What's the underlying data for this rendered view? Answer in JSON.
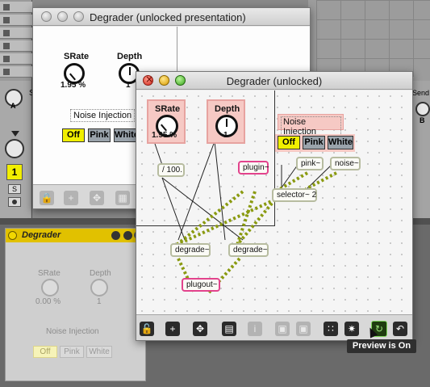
{
  "back_window": {
    "title": "Degrader (unlocked presentation)",
    "srate_label": "SRate",
    "srate_value": "1.95 %",
    "depth_label": "Depth",
    "depth_value": "1",
    "noise_label": "Noise Injection",
    "noise_options": [
      "Off",
      "Pink",
      "White"
    ]
  },
  "front_window": {
    "title": "Degrader (unlocked)",
    "srate_label": "SRate",
    "srate_value": "1.95 %",
    "depth_label": "Depth",
    "depth_value": "1",
    "noise_label": "Noise Injection",
    "noise_options": [
      "Off",
      "Pink",
      "White"
    ],
    "objects": {
      "divide": "/ 100.",
      "plugin": "plugin~",
      "pink": "pink~",
      "noise": "noise~",
      "selector": "selector~ 2",
      "degrade_left": "degrade~",
      "degrade_right": "degrade~",
      "plugout": "plugout~"
    }
  },
  "device": {
    "title": "Degrader",
    "srate_label": "SRate",
    "srate_value": "0.00 %",
    "depth_label": "Depth",
    "depth_value": "1",
    "noise_label": "Noise Injection",
    "noise_options": [
      "Off",
      "Pink",
      "White"
    ]
  },
  "live": {
    "knob_a": "A",
    "knob_b": "B",
    "sends_left": "S",
    "sends_right": "Send",
    "track_number": "1",
    "solo_label": "S"
  },
  "tooltip": "Preview is On"
}
